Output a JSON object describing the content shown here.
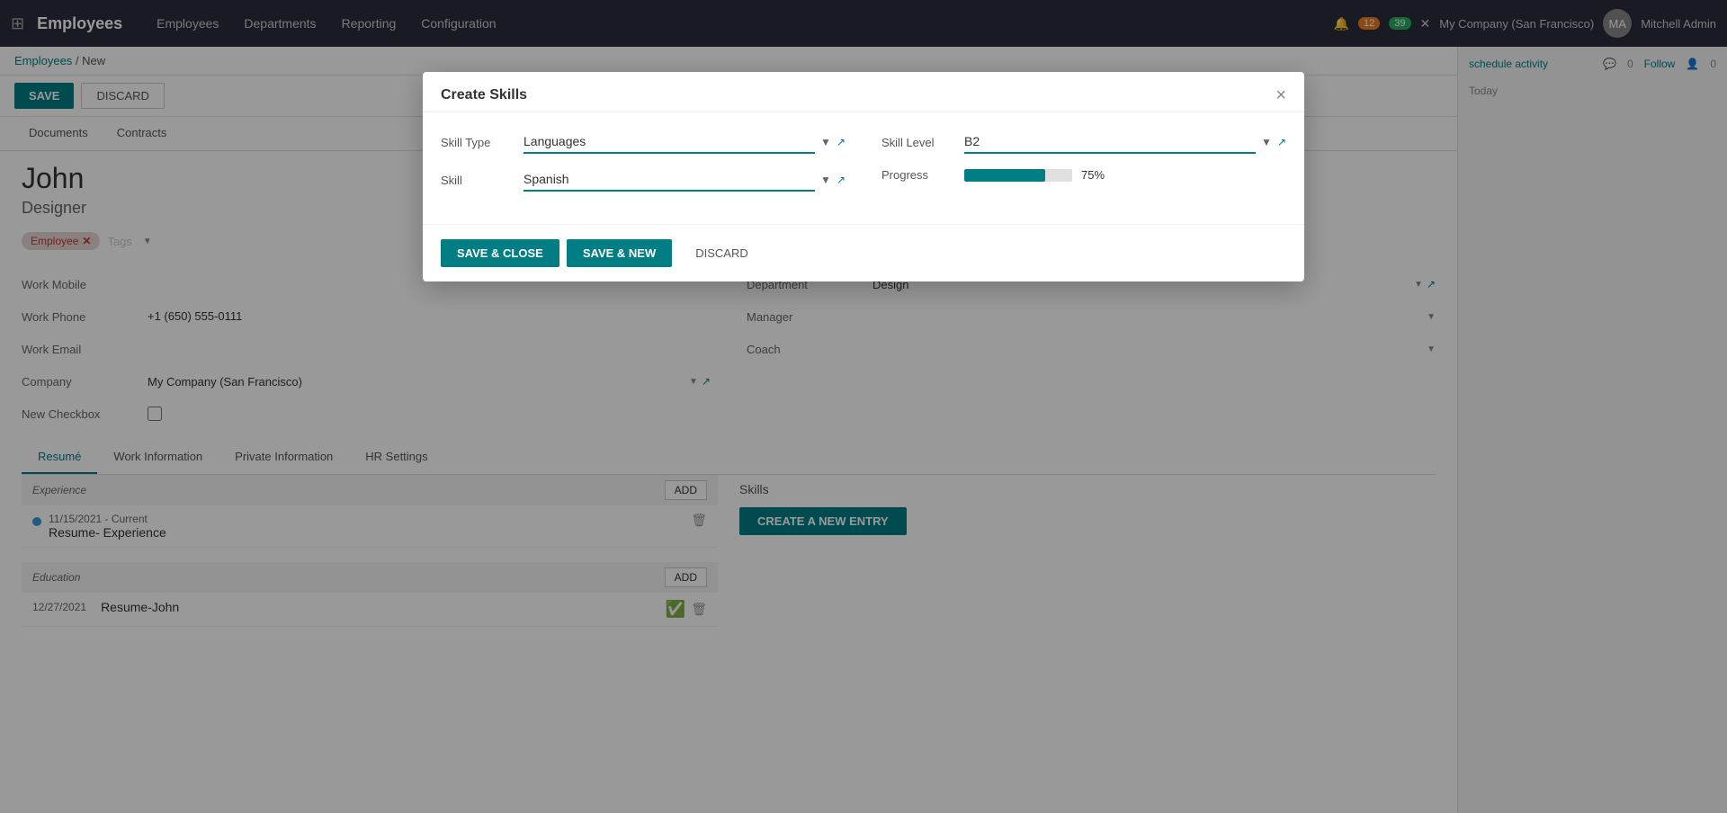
{
  "app": {
    "brand": "Employees",
    "nav_items": [
      "Employees",
      "Departments",
      "Reporting",
      "Configuration"
    ],
    "company": "My Company (San Francisco)",
    "user": "Mitchell Admin",
    "badge1": "12",
    "badge2": "39"
  },
  "breadcrumb": {
    "parent": "Employees",
    "current": "New"
  },
  "toolbar": {
    "save_label": "SAVE",
    "discard_label": "DISCARD"
  },
  "top_tabs": [
    "Documents",
    "Contracts"
  ],
  "employee": {
    "name": "John",
    "title": "Designer",
    "tag": "Employee"
  },
  "form_fields": {
    "work_mobile_label": "Work Mobile",
    "work_phone_label": "Work Phone",
    "work_phone_value": "+1 (650) 555-0111",
    "work_email_label": "Work Email",
    "company_label": "Company",
    "company_value": "My Company (San Francisco)",
    "new_checkbox_label": "New Checkbox",
    "department_label": "Department",
    "department_value": "Design",
    "manager_label": "Manager",
    "coach_label": "Coach"
  },
  "tabs": {
    "items": [
      "Resumé",
      "Work Information",
      "Private Information",
      "HR Settings"
    ],
    "active": 0
  },
  "resume": {
    "experience_label": "Experience",
    "education_label": "Education",
    "add_label": "ADD",
    "experience_items": [
      {
        "date": "11/15/2021 - Current",
        "title": "Resume- Experience"
      }
    ],
    "education_items": [
      {
        "date": "12/27/2021",
        "title": "Resume-John"
      }
    ]
  },
  "skills": {
    "label": "Skills",
    "create_entry_label": "CREATE A NEW ENTRY"
  },
  "sidebar": {
    "schedule_activity": "schedule activity",
    "follow_label": "Follow",
    "followers": "0",
    "messages": "0",
    "today_label": "Today"
  },
  "modal": {
    "title": "Create Skills",
    "skill_type_label": "Skill Type",
    "skill_type_value": "Languages",
    "skill_label": "Skill",
    "skill_value": "Spanish",
    "skill_level_label": "Skill Level",
    "skill_level_value": "B2",
    "progress_label": "Progress",
    "progress_value": 75,
    "progress_text": "75%",
    "save_close_label": "SAVE & CLOSE",
    "save_new_label": "SAVE & NEW",
    "discard_label": "DISCARD",
    "close_label": "×"
  }
}
